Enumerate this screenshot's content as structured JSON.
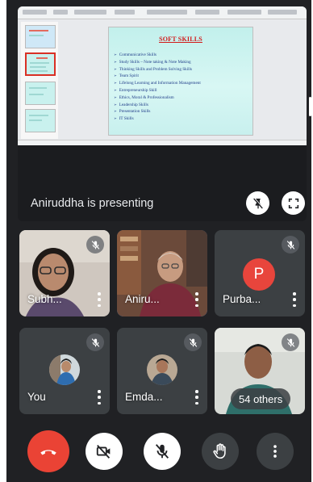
{
  "presentation": {
    "label": "Aniruddha is presenting",
    "slide_title": "SOFT SKILLS",
    "slide_items": [
      "Communicative Skills",
      "Study Skills – Note taking & Note Making",
      "Thinking Skills and Problem Solving Skills",
      "Team Spirit",
      "Lifelong Learning and Information Management",
      "Entrepreneurship Skill",
      "Ethics, Moral & Professionalism",
      "Leadership Skills",
      "Presentation Skills",
      "IT Skills"
    ],
    "pin_icon": "pin-off-icon",
    "fullscreen_icon": "fullscreen-icon"
  },
  "participants": [
    {
      "name": "Subh...",
      "muted": true
    },
    {
      "name": "Aniru...",
      "muted": false,
      "active_speaker": true
    },
    {
      "name": "Purba...",
      "muted": true,
      "initial": "P"
    },
    {
      "name": "You",
      "muted": true
    },
    {
      "name": "Emda...",
      "muted": true
    },
    {
      "name": "",
      "muted": true,
      "others_label": "54 others"
    }
  ],
  "controls": {
    "leave": "hang-up-icon",
    "camera": "camera-off-icon",
    "mic": "mic-off-icon",
    "hand": "raise-hand-icon",
    "more": "more-vert-icon"
  },
  "colors": {
    "background": "#202124",
    "tile": "#3c4043",
    "leave": "#ea4335",
    "avatar_p": "#e8453c",
    "active_border": "#1a73e8"
  }
}
